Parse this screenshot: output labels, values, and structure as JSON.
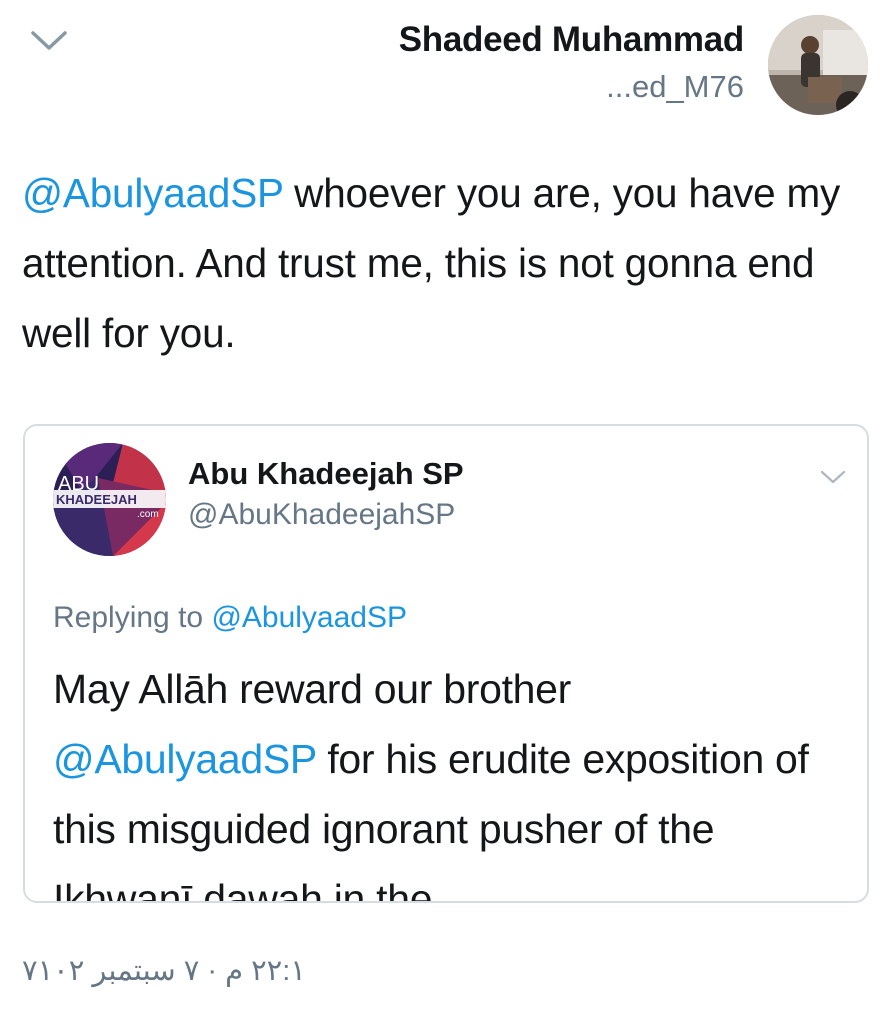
{
  "header": {
    "author_name": "Shadeed Muhammad",
    "author_handle": "...ed_M76",
    "menu_icon": "chevron-down-icon"
  },
  "tweet": {
    "mention": "@AbulyaadSP",
    "text": " whoever you are, you have my attention. And trust me, this is not gonna end well for you."
  },
  "quoted_tweet": {
    "author_name": "Abu Khadeejah SP",
    "author_handle": "@AbuKhadeejahSP",
    "avatar_text": {
      "line1": "ABU",
      "line2": "KHADEEJAH",
      "line3": ".com"
    },
    "replying_prefix": "Replying to ",
    "replying_to": "@AbulyaadSP",
    "text_part1": "May Allāh reward our brother",
    "text_mention": "@AbulyaadSP",
    "text_part2": " for his erudite exposition of this misguided ignorant pusher of the Ikhwanī dawah in the"
  },
  "timestamp": "١:٢٢ م · ٧ سبتمبر ٢٠١٧",
  "colors": {
    "link": "#1b95e0",
    "secondary": "#657786",
    "border": "#d6dde2"
  }
}
